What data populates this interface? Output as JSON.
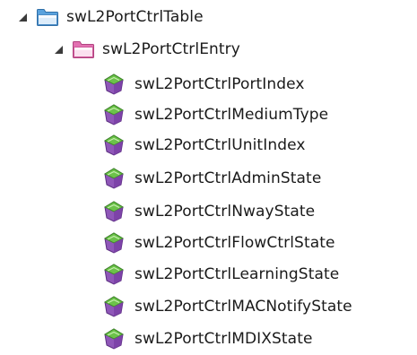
{
  "tree": {
    "table": {
      "label": "swL2PortCtrlTable",
      "icon": "folder-blue-icon",
      "color": "#3a86c8",
      "expanded": true
    },
    "entry": {
      "label": "swL2PortCtrlEntry",
      "icon": "folder-pink-icon",
      "color": "#d9579e",
      "expanded": true
    },
    "leaves": [
      {
        "label": "swL2PortCtrlPortIndex",
        "icon": "mib-leaf-icon"
      },
      {
        "label": "swL2PortCtrlMediumType",
        "icon": "mib-leaf-icon"
      },
      {
        "label": "swL2PortCtrlUnitIndex",
        "icon": "mib-leaf-icon"
      },
      {
        "label": "swL2PortCtrlAdminState",
        "icon": "mib-leaf-icon"
      },
      {
        "label": "swL2PortCtrlNwayState",
        "icon": "mib-leaf-icon"
      },
      {
        "label": "swL2PortCtrlFlowCtrlState",
        "icon": "mib-leaf-icon"
      },
      {
        "label": "swL2PortCtrlLearningState",
        "icon": "mib-leaf-icon"
      },
      {
        "label": "swL2PortCtrlMACNotifyState",
        "icon": "mib-leaf-icon"
      },
      {
        "label": "swL2PortCtrlMDIXState",
        "icon": "mib-leaf-icon"
      }
    ]
  }
}
